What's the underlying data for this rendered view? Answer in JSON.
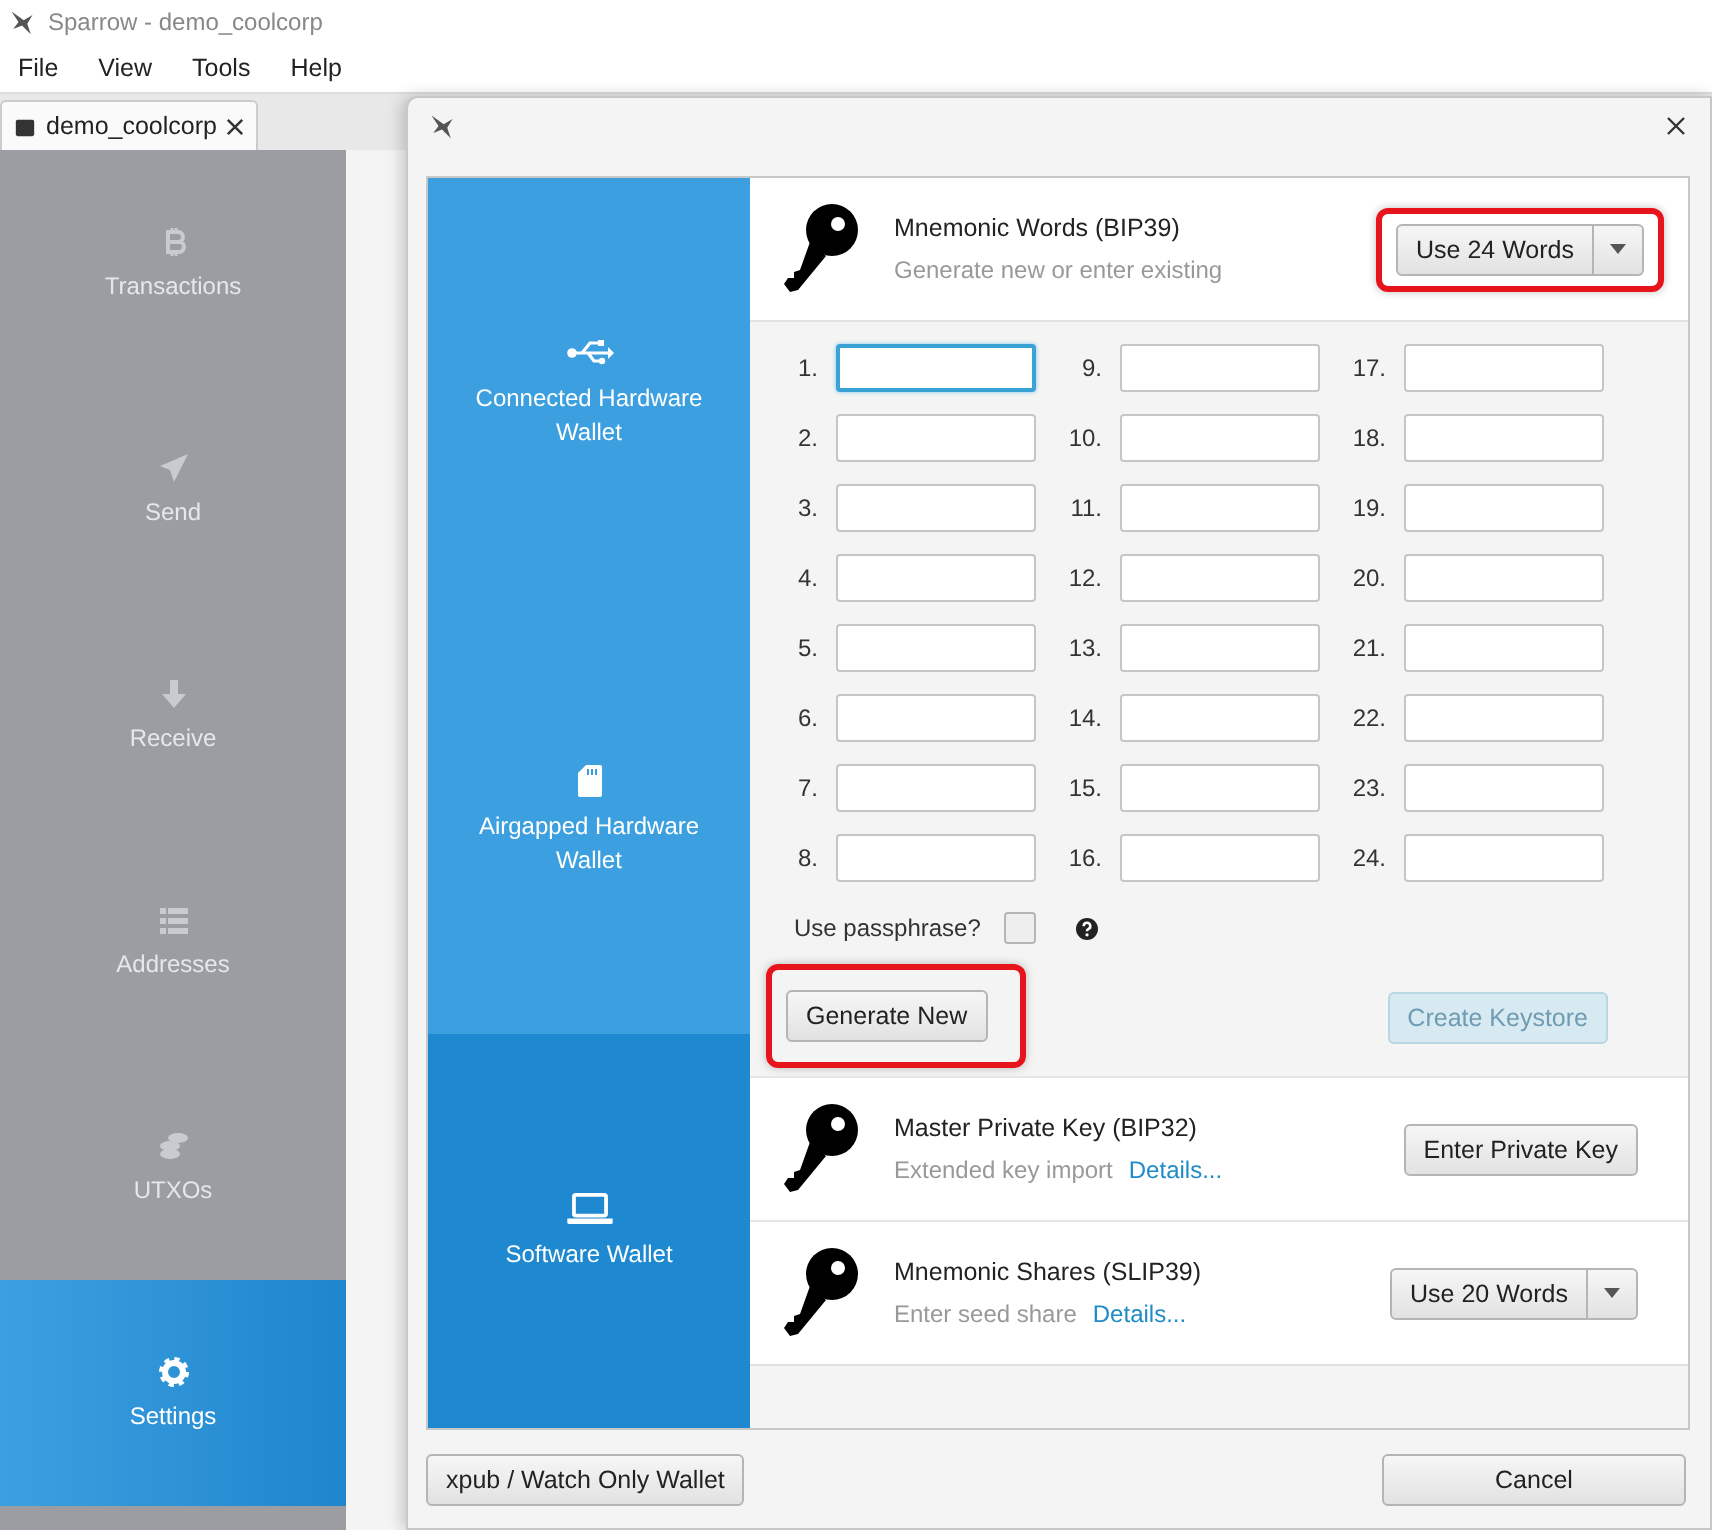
{
  "window": {
    "title": "Sparrow - demo_coolcorp"
  },
  "menu": [
    "File",
    "View",
    "Tools",
    "Help"
  ],
  "tabs": [
    {
      "label": "demo_coolcorp",
      "selected": true
    }
  ],
  "nav": [
    {
      "label": "Transactions",
      "kind": "bitcoin",
      "selected": false
    },
    {
      "label": "Send",
      "kind": "send",
      "selected": false
    },
    {
      "label": "Receive",
      "kind": "receive",
      "selected": false
    },
    {
      "label": "Addresses",
      "kind": "addresses",
      "selected": false
    },
    {
      "label": "UTXOs",
      "kind": "utxos",
      "selected": false
    },
    {
      "label": "Settings",
      "kind": "settings",
      "selected": true
    }
  ],
  "dialog": {
    "types": [
      {
        "label": "Connected Hardware Wallet",
        "kind": "usb",
        "selected": false
      },
      {
        "label": "Airgapped Hardware Wallet",
        "kind": "sdcard",
        "selected": false
      },
      {
        "label": "Software Wallet",
        "kind": "laptop",
        "selected": true
      }
    ],
    "mnemonic": {
      "title": "Mnemonic Words (BIP39)",
      "subtitle": "Generate new or enter existing",
      "button": "Use 24 Words",
      "highlighted": true
    },
    "words": [
      {
        "number": "1.",
        "focused": true
      },
      {
        "number": "2.",
        "focused": false
      },
      {
        "number": "3.",
        "focused": false
      },
      {
        "number": "4.",
        "focused": false
      },
      {
        "number": "5.",
        "focused": false
      },
      {
        "number": "6.",
        "focused": false
      },
      {
        "number": "7.",
        "focused": false
      },
      {
        "number": "8.",
        "focused": false
      },
      {
        "number": "9.",
        "focused": false
      },
      {
        "number": "10.",
        "focused": false
      },
      {
        "number": "11.",
        "focused": false
      },
      {
        "number": "12.",
        "focused": false
      },
      {
        "number": "13.",
        "focused": false
      },
      {
        "number": "14.",
        "focused": false
      },
      {
        "number": "15.",
        "focused": false
      },
      {
        "number": "16.",
        "focused": false
      },
      {
        "number": "17.",
        "focused": false
      },
      {
        "number": "18.",
        "focused": false
      },
      {
        "number": "19.",
        "focused": false
      },
      {
        "number": "20.",
        "focused": false
      },
      {
        "number": "21.",
        "focused": false
      },
      {
        "number": "22.",
        "focused": false
      },
      {
        "number": "23.",
        "focused": false
      },
      {
        "number": "24.",
        "focused": false
      }
    ],
    "passphrase": {
      "label": "Use passphrase?",
      "checked": false
    },
    "generate_button": {
      "label": "Generate New",
      "highlighted": true
    },
    "create_button": {
      "label": "Create Keystore",
      "disabled": true
    },
    "others": [
      {
        "title": "Master Private Key (BIP32)",
        "subtitle": "Extended key import",
        "link": "Details...",
        "button": "Enter Private Key",
        "kind": "button"
      },
      {
        "title": "Mnemonic Shares (SLIP39)",
        "subtitle": "Enter seed share",
        "link": "Details...",
        "button": "Use 20 Words",
        "kind": "split"
      }
    ],
    "footer": {
      "watch_button": "xpub / Watch Only Wallet",
      "cancel_button": "Cancel"
    }
  }
}
